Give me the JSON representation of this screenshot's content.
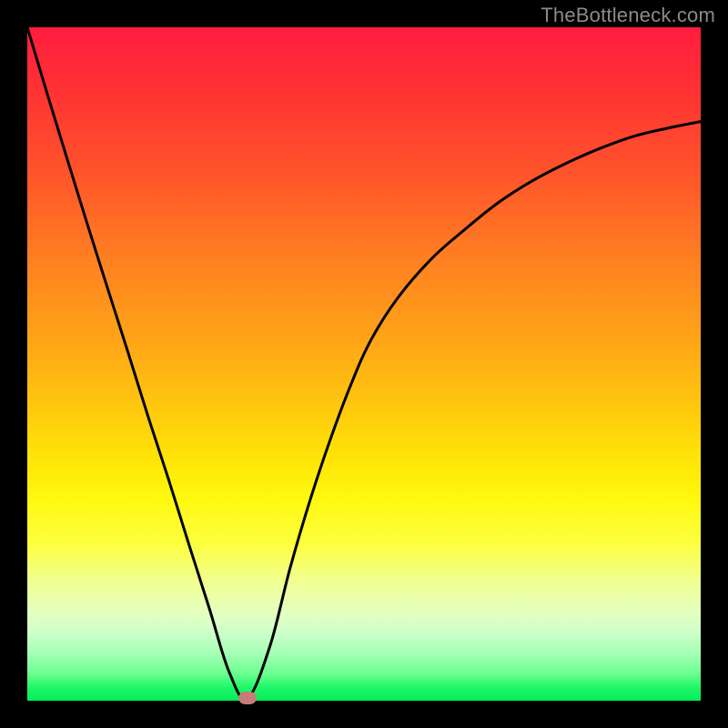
{
  "attribution": "TheBottleneck.com",
  "chart_data": {
    "type": "line",
    "title": "",
    "xlabel": "",
    "ylabel": "",
    "xlim": [
      0,
      1
    ],
    "ylim": [
      0,
      1
    ],
    "x": [
      0.0,
      0.03,
      0.06,
      0.09,
      0.12,
      0.15,
      0.18,
      0.21,
      0.24,
      0.27,
      0.3,
      0.327,
      0.36,
      0.39,
      0.42,
      0.45,
      0.48,
      0.51,
      0.55,
      0.6,
      0.65,
      0.7,
      0.75,
      0.8,
      0.85,
      0.9,
      0.95,
      1.0
    ],
    "values": [
      1.0,
      0.9,
      0.802,
      0.705,
      0.61,
      0.516,
      0.42,
      0.328,
      0.232,
      0.138,
      0.042,
      0.004,
      0.08,
      0.196,
      0.298,
      0.388,
      0.468,
      0.535,
      0.598,
      0.656,
      0.7,
      0.74,
      0.772,
      0.798,
      0.82,
      0.838,
      0.85,
      0.86
    ],
    "annotations": [
      {
        "type": "marker",
        "x": 0.327,
        "y": 0.004,
        "color": "#c97b7b"
      }
    ],
    "background_gradient": {
      "direction": "vertical",
      "stops": [
        {
          "pos": 0.0,
          "color": "#ff1c3f"
        },
        {
          "pos": 0.5,
          "color": "#ffb012"
        },
        {
          "pos": 0.7,
          "color": "#fff80e"
        },
        {
          "pos": 0.9,
          "color": "#ccffca"
        },
        {
          "pos": 1.0,
          "color": "#00ee57"
        }
      ]
    }
  }
}
